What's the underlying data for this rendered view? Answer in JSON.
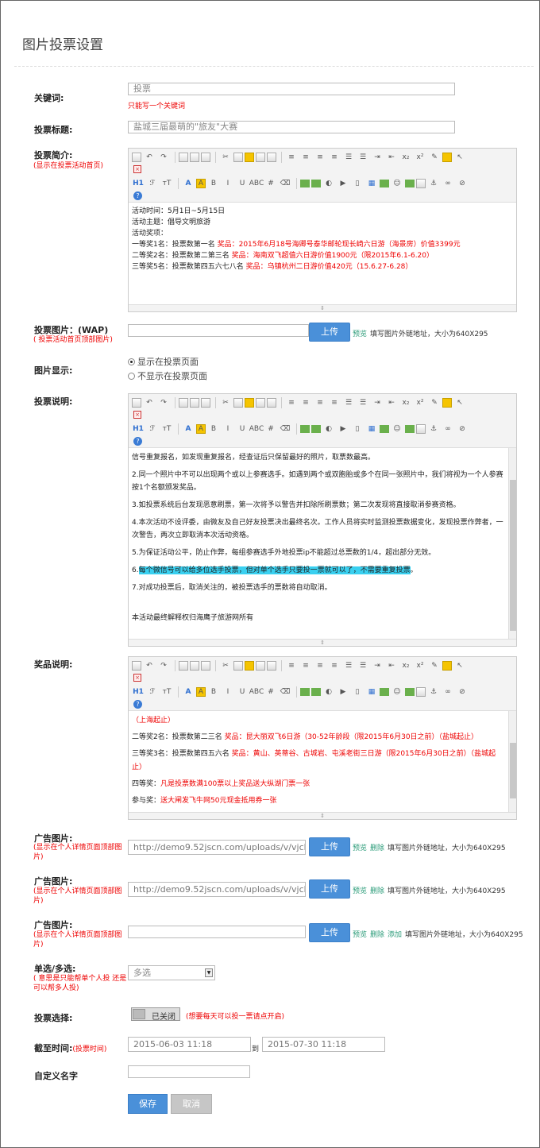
{
  "page_title": "图片投票设置",
  "keyword": {
    "label": "关键词:",
    "placeholder": "投票",
    "note": "只能写一个关键词"
  },
  "vote_title": {
    "label": "投票标题:",
    "placeholder": "盐城三届最萌的\"旅友\"大赛"
  },
  "intro": {
    "label": "投票简介:",
    "sub": "(显示在投票活动首页)",
    "lines": [
      {
        "text": "活动时间：5月1日~5月15日"
      },
      {
        "text": "活动主题：倡导文明旅游"
      },
      {
        "text": "活动奖项："
      },
      {
        "text": "一等奖1名：投票数第一名 ",
        "red": "奖品：2015年6月18号海卿号泰华邮轮现长崎六日游（海景房）价值3399元"
      },
      {
        "text": "二等奖2名：投票数第二第三名 ",
        "red": "奖品：海南双飞超值六日游价值1900元（限2015年6.1-6.20）"
      },
      {
        "text": "三等奖5名：投票数第四五六七八名 ",
        "red": "奖品：乌镇杭州二日游价值420元（15.6.27-6.28）"
      }
    ]
  },
  "vote_image": {
    "label": "投票图片：(WAP)",
    "sub": "( 投票活动首页顶部图片)",
    "upload": "上传",
    "preview": "预览",
    "hint": "填写图片外链地址，大小为640X295"
  },
  "image_display": {
    "label": "图片显示:",
    "options": [
      "显示在投票页面",
      "不显示在投票页面"
    ]
  },
  "vote_desc": {
    "label": "投票说明:",
    "paras": [
      {
        "text": "信号重复报名，如发现重复报名，经查证后只保留最好的照片，取票数最高。"
      },
      {
        "text": "2.同一个照片中不可以出现两个或以上参赛选手。如遇到两个或双胞胎或多个在同一张照片中，我们将视为一个人参赛按1个名额颁发奖品。"
      },
      {
        "text": "3.如投票系统后台发现恶意刷票，第一次将予以警告并扣除所刷票数；第二次发现将直接取消参赛资格。"
      },
      {
        "text": "4.本次活动不设评委，由微友及自己好友投票决出最终名次。工作人员将实时监测投票数据变化，发现投票作弊者，一次警告，两次立即取消本次活动资格。"
      },
      {
        "text": "5.为保证活动公平，防止作弊，每组参赛选手外地投票ip不能超过总票数的1/4，超出部分无效。"
      },
      {
        "text": "6.",
        "hl": "每个微信号可以给多位选手投票，但对单个选手只要投一票就可以了，不需要重复投票",
        "tail": "。"
      },
      {
        "text": "7.对成功投票后，取消关注的，被投票选手的票数将自动取消。"
      },
      {
        "text": ""
      },
      {
        "text": "本活动最终解释权归海鹰子旅游网所有"
      }
    ]
  },
  "prize_desc": {
    "label": "奖品说明:",
    "lines": [
      {
        "red": "（上海起止）"
      },
      {
        "text": "二等奖2名：投票数第二三名 ",
        "red": "奖品：昆大丽双飞6日游（30-52年龄段（限2015年6月30日之前）（盐城起止）"
      },
      {
        "text": "三等奖3名：投票数第四五六名 ",
        "red": "奖品：黄山、英蒂谷、古城岩、屯溪老街三日游（限2015年6月30日之前）（盐城起止）"
      },
      {
        "text": "四等奖：",
        "red": "凡是投票数满100票以上奖品送大纵湖门票一张"
      },
      {
        "text": "参与奖：",
        "red": "送大闸发飞牛网50元现金抵用券一张"
      }
    ]
  },
  "ads": [
    {
      "label": "广告图片:",
      "sub": "(显示在个人详情页面顶部图片)",
      "value": "http://demo9.52jscn.com/uploads/v/vjcbgt14",
      "upload": "上传",
      "links": [
        "预览",
        "删除"
      ],
      "hint": "填写图片外链地址，大小为640X295"
    },
    {
      "label": "广告图片:",
      "sub": "(显示在个人详情页面顶部图片)",
      "value": "http://demo9.52jscn.com/uploads/v/vjcbgt14",
      "upload": "上传",
      "links": [
        "预览",
        "删除"
      ],
      "hint": "填写图片外链地址，大小为640X295"
    },
    {
      "label": "广告图片:",
      "sub": "(显示在个人详情页面顶部图片)",
      "value": "",
      "upload": "上传",
      "links": [
        "预览",
        "删除",
        "添加"
      ],
      "hint": "填写图片外链地址，大小为640X295"
    }
  ],
  "select_mode": {
    "label": "单选/多选:",
    "sub": "( 意思是只能帮单个人投 还是可以帮多人投)",
    "value": "多选"
  },
  "vote_choice": {
    "label": "投票选择:",
    "toggle": "已关闭",
    "note": "(想要每天可以投一票请点开启)"
  },
  "deadline": {
    "label": "截至时间:",
    "sub": "(投票时间)",
    "start": "2015-06-03 11:18",
    "sep": "到",
    "end": "2015-07-30 11:18"
  },
  "custom_name": {
    "label": "自定义名字",
    "value": ""
  },
  "actions": {
    "save": "保存",
    "cancel": "取消"
  }
}
